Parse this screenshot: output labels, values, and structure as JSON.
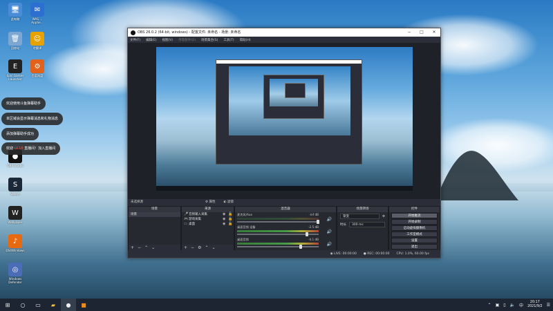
{
  "desktop": {
    "icons": [
      {
        "label": "此电脑",
        "glyph": "🖥",
        "color": "#4b8cd6"
      },
      {
        "label": "WAS ...\nAppSe...",
        "glyph": "✉",
        "color": "#2c6fd1"
      },
      {
        "label": "回收站",
        "glyph": "🗑",
        "color": "#7da7d2"
      },
      {
        "label": "宅翻译",
        "glyph": "☺",
        "color": "#e8a200"
      },
      {
        "label": "Epic Games\nLauncher",
        "glyph": "E",
        "color": "#222222"
      },
      {
        "label": "百度网盘",
        "glyph": "⚙",
        "color": "#e2621c"
      },
      {
        "label": "OBS Studio",
        "glyph": "●",
        "color": "#111111"
      },
      {
        "label": "Steam",
        "glyph": "S",
        "color": "#1b2838"
      },
      {
        "label": "Wallpaper",
        "glyph": "W",
        "color": "#222222"
      },
      {
        "label": "DS4Windows",
        "glyph": "♪",
        "color": "#e86a10"
      },
      {
        "label": "Windows\nDefender",
        "glyph": "◎",
        "color": "#4b6cb7"
      }
    ]
  },
  "toasts": [
    {
      "text": "欢迎使用斗鱼弹幕助手"
    },
    {
      "text": "本区域会显示弹幕消息和礼物消息"
    },
    {
      "text": "添加弹幕助手成功"
    },
    {
      "pre": "欢迎 ",
      "highlight": "​​LV.18",
      "post": " 直播间！加入直播间"
    }
  ],
  "obs": {
    "title": "OBS 26.0.2 (64-bit, windows) - 配置文件: 未命名 - 场景: 未命名",
    "menu": [
      "文件(F)",
      "编辑(E)",
      "视图(V)",
      "停靠部件(D)",
      "场景集合(S)",
      "工具(T)",
      "帮助(H)"
    ],
    "scene_bar": {
      "label": "未选择源",
      "props": "属性",
      "filters": "滤镜"
    },
    "docks": {
      "scenes": {
        "title": "场景",
        "items": [
          "场景"
        ]
      },
      "sources": {
        "title": "来源",
        "items": [
          {
            "name": "音频输入采集",
            "icon": "🎤"
          },
          {
            "name": "游戏采集",
            "icon": "🎮"
          },
          {
            "name": "桌面",
            "icon": "▭"
          }
        ]
      },
      "mixer": {
        "title": "混音器",
        "channels": [
          {
            "name": "麦克风/Aux",
            "db": "-inf dB"
          },
          {
            "name": "桌面音频 设备",
            "db": "-2.5 dB"
          },
          {
            "name": "桌面音频",
            "db": "-4.1 dB"
          }
        ]
      },
      "transitions": {
        "title": "场景转场",
        "type": "渐变",
        "duration_label": "时长",
        "duration": "300 ms"
      },
      "controls": {
        "title": "控件",
        "buttons": [
          "开始推流",
          "开始录制",
          "启动虚拟摄像机",
          "工作室模式",
          "设置",
          "退出"
        ]
      }
    },
    "status": {
      "live": "LIVE: 00:00:00",
      "rec": "REC: 00:00:00",
      "cpu": "CPU: 1.0%, 60.00 fps"
    }
  },
  "taskbar": {
    "time": "20:17",
    "date": "2021/9/2"
  }
}
